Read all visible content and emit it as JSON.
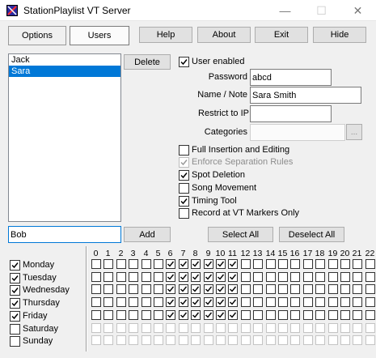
{
  "window": {
    "title": "StationPlaylist VT Server",
    "minimize_glyph": "—",
    "maximize_glyph": "☐",
    "close_glyph": "✕",
    "icon": "app-logo-icon"
  },
  "tabs": [
    {
      "label": "Options"
    },
    {
      "label": "Users"
    }
  ],
  "toolbar": {
    "help_label": "Help",
    "about_label": "About",
    "exit_label": "Exit",
    "hide_label": "Hide"
  },
  "users": {
    "items": [
      {
        "label": "Jack"
      },
      {
        "label": "Sara"
      }
    ],
    "selected": "Sara",
    "delete_label": "Delete",
    "new_user_value": "Bob",
    "add_label": "Add"
  },
  "details": {
    "user_enabled_label": "User enabled",
    "password_label": "Password",
    "password_value": "abcd",
    "name_label": "Name / Note",
    "name_value": "Sara Smith",
    "restrict_ip_label": "Restrict to IP",
    "restrict_ip_value": "",
    "categories_label": "Categories",
    "categories_value": "",
    "categories_button": "...",
    "permissions": [
      {
        "label": "Full Insertion and Editing",
        "checked": false,
        "disabled": false
      },
      {
        "label": "Enforce Separation Rules",
        "checked": true,
        "disabled": true
      },
      {
        "label": "Spot Deletion",
        "checked": true,
        "disabled": false
      },
      {
        "label": "Song Movement",
        "checked": false,
        "disabled": false
      },
      {
        "label": "Timing Tool",
        "checked": true,
        "disabled": false
      },
      {
        "label": "Record at VT Markers Only",
        "checked": false,
        "disabled": false
      }
    ]
  },
  "schedule": {
    "select_all_label": "Select All",
    "deselect_all_label": "Deselect All",
    "hours": [
      "0",
      "1",
      "2",
      "3",
      "4",
      "5",
      "6",
      "7",
      "8",
      "9",
      "10",
      "11",
      "12",
      "13",
      "14",
      "15",
      "16",
      "17",
      "18",
      "19",
      "20",
      "21",
      "22",
      "23"
    ],
    "days": [
      {
        "label": "Monday",
        "enabled": true,
        "checked_hours": [
          6,
          7,
          8,
          9,
          10,
          11
        ]
      },
      {
        "label": "Tuesday",
        "enabled": true,
        "checked_hours": [
          6,
          7,
          8,
          9,
          10,
          11
        ]
      },
      {
        "label": "Wednesday",
        "enabled": true,
        "checked_hours": [
          6,
          7,
          8,
          9,
          10,
          11
        ]
      },
      {
        "label": "Thursday",
        "enabled": true,
        "checked_hours": [
          6,
          7,
          8,
          9,
          10,
          11
        ]
      },
      {
        "label": "Friday",
        "enabled": true,
        "checked_hours": [
          6,
          7,
          8,
          9,
          10,
          11
        ]
      },
      {
        "label": "Saturday",
        "enabled": false,
        "checked_hours": []
      },
      {
        "label": "Sunday",
        "enabled": false,
        "checked_hours": []
      }
    ]
  }
}
